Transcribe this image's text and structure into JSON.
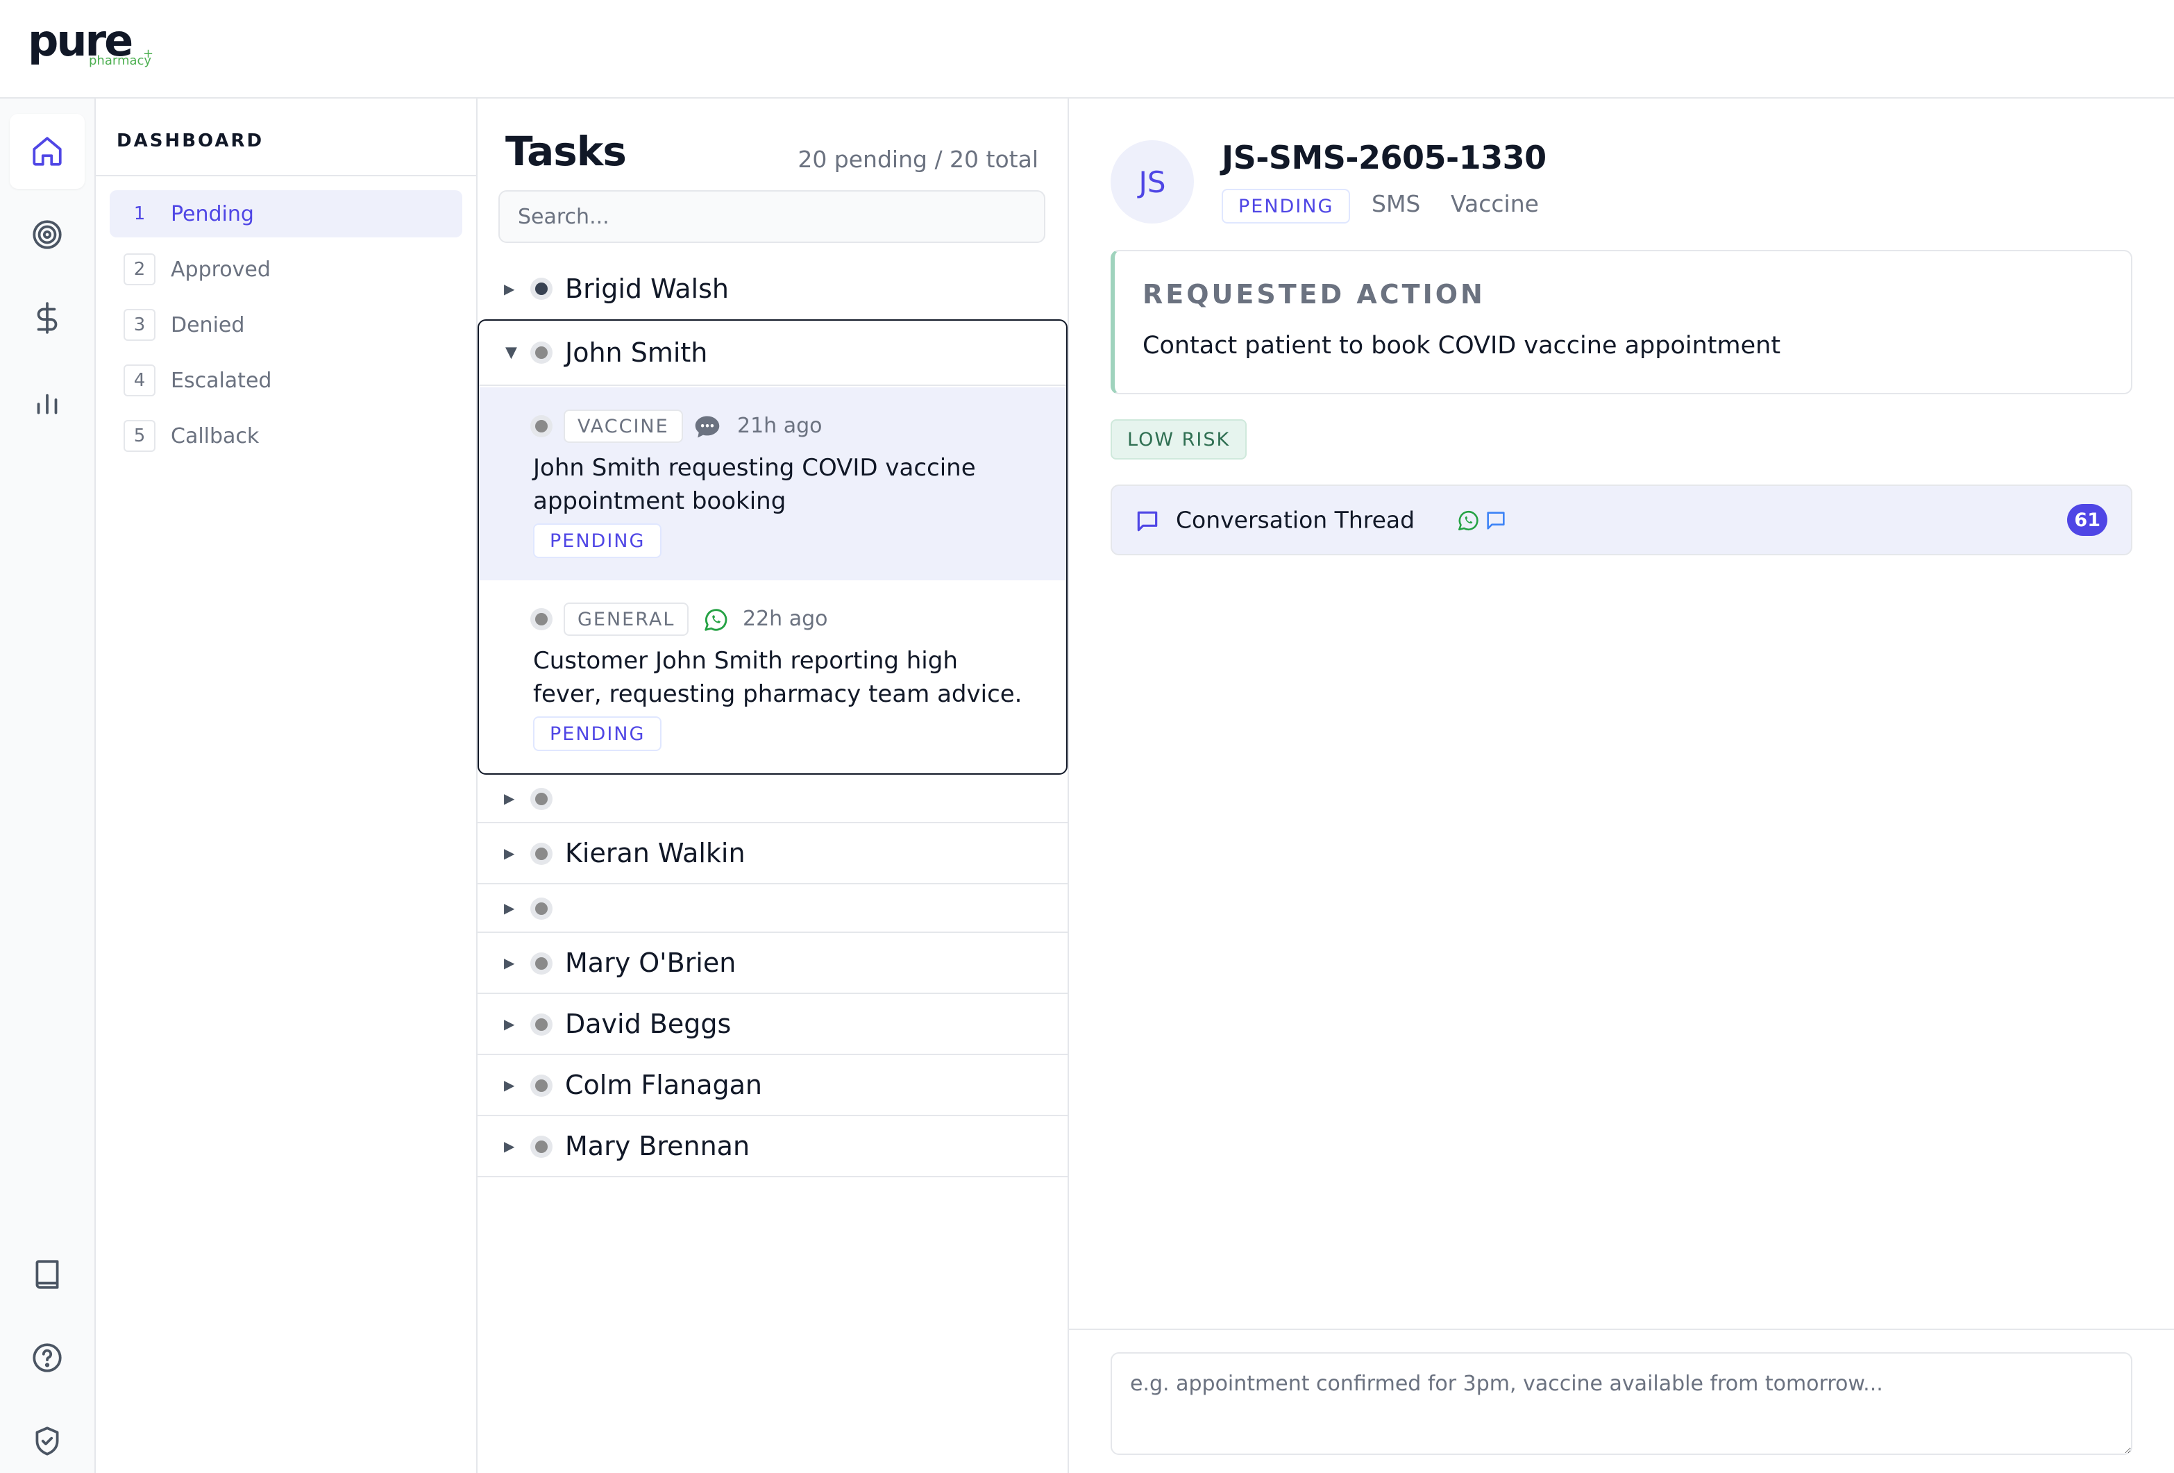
{
  "brand": {
    "logo_word": "pure",
    "logo_sub": "pharmacy",
    "logo_plus": "+"
  },
  "rail": {
    "icons": [
      "home-icon",
      "target-icon",
      "dollar-icon",
      "bar-chart-icon",
      "book-icon",
      "help-icon",
      "shield-check-icon"
    ],
    "active": "home-icon"
  },
  "dashboard": {
    "title": "DASHBOARD",
    "items": [
      {
        "num": "1",
        "label": "Pending",
        "active": true
      },
      {
        "num": "2",
        "label": "Approved",
        "active": false
      },
      {
        "num": "3",
        "label": "Denied",
        "active": false
      },
      {
        "num": "4",
        "label": "Escalated",
        "active": false
      },
      {
        "num": "5",
        "label": "Callback",
        "active": false
      }
    ]
  },
  "tasks": {
    "title": "Tasks",
    "count": "20 pending / 20 total",
    "search_placeholder": "Search...",
    "groups": [
      {
        "name": "Brigid Walsh",
        "expanded": false
      },
      {
        "name": "John Smith",
        "expanded": true
      },
      {
        "name": "",
        "expanded": false
      },
      {
        "name": "Kieran Walkin",
        "expanded": false
      },
      {
        "name": "",
        "expanded": false
      },
      {
        "name": "Mary O'Brien",
        "expanded": false
      },
      {
        "name": "David Beggs",
        "expanded": false
      },
      {
        "name": "Colm Flanagan",
        "expanded": false
      },
      {
        "name": "Mary Brennan",
        "expanded": false
      }
    ],
    "expanded_items": [
      {
        "tag": "VACCINE",
        "channel_icon": "chat-bubble-icon",
        "time": "21h ago",
        "text": "John Smith requesting COVID vaccine appointment booking",
        "status": "PENDING",
        "selected": true
      },
      {
        "tag": "GENERAL",
        "channel_icon": "whatsapp-icon",
        "time": "22h ago",
        "text": "Customer John Smith reporting high fever, requesting pharmacy team advice.",
        "status": "PENDING",
        "selected": false
      }
    ]
  },
  "detail": {
    "avatar": "JS",
    "title": "JS-SMS-2605-1330",
    "status": "PENDING",
    "channel": "SMS",
    "category": "Vaccine",
    "requested_action_label": "REQUESTED ACTION",
    "requested_action": "Contact patient to book COVID vaccine appointment",
    "risk": "LOW RISK",
    "thread_label": "Conversation Thread",
    "thread_count": "61",
    "reply_placeholder": "e.g. appointment confirmed for 3pm, vaccine available from tomorrow..."
  },
  "colors": {
    "accent": "#4f46e5",
    "accent_bg": "#eef0fb",
    "risk_bg": "#e6f4ee",
    "risk_text": "#2f6f52",
    "whatsapp": "#25a244"
  }
}
